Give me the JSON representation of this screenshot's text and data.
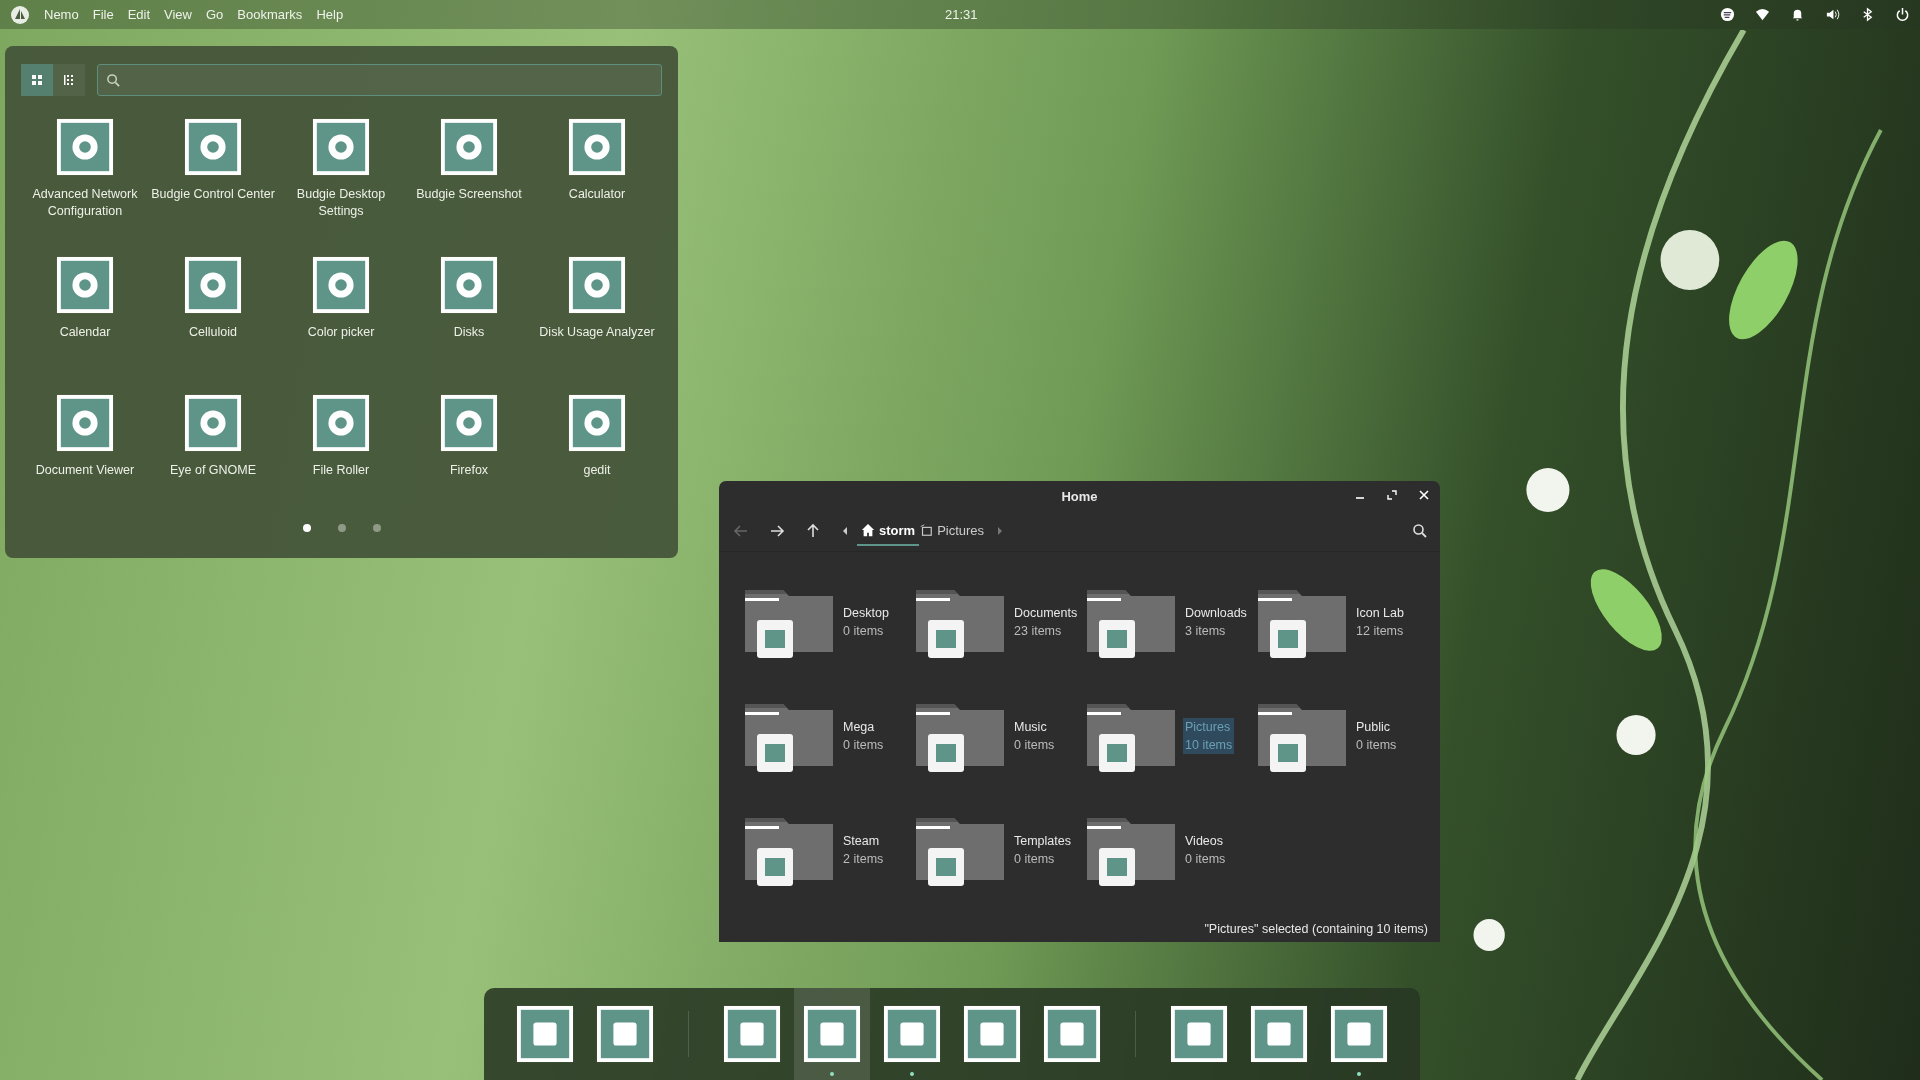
{
  "top_bar": {
    "menu": [
      "Nemo",
      "File",
      "Edit",
      "View",
      "Go",
      "Bookmarks",
      "Help"
    ],
    "clock": "21:31"
  },
  "app_launcher": {
    "view_modes": [
      {
        "kind": "grid",
        "selected": true
      },
      {
        "kind": "list",
        "selected": false
      }
    ],
    "apps": [
      "Advanced Network Configuration",
      "Budgie Control Center",
      "Budgie Desktop Settings",
      "Budgie Screenshot",
      "Calculator",
      "Calendar",
      "Celluloid",
      "Color picker",
      "Disks",
      "Disk Usage Analyzer",
      "Document Viewer",
      "Eye of GNOME",
      "File Roller",
      "Firefox",
      "gedit"
    ],
    "pages": [
      {
        "selected": true
      },
      {
        "selected": false
      },
      {
        "selected": false
      }
    ]
  },
  "file_manager": {
    "window": {
      "title": "Home"
    },
    "path": [
      {
        "kind": "home",
        "label": "storm",
        "selected": true
      },
      {
        "kind": "folder",
        "label": "Pictures",
        "selected": false
      }
    ],
    "folders": [
      {
        "name": "Desktop",
        "count": "0 items",
        "selected": false
      },
      {
        "name": "Documents",
        "count": "23 items",
        "selected": false
      },
      {
        "name": "Downloads",
        "count": "3 items",
        "selected": false
      },
      {
        "name": "Icon Lab",
        "count": "12 items",
        "selected": false
      },
      {
        "name": "Mega",
        "count": "0 items",
        "selected": false
      },
      {
        "name": "Music",
        "count": "0 items",
        "selected": false
      },
      {
        "name": "Pictures",
        "count": "10 items",
        "selected": true
      },
      {
        "name": "Public",
        "count": "0 items",
        "selected": false
      },
      {
        "name": "Steam",
        "count": "2 items",
        "selected": false
      },
      {
        "name": "Templates",
        "count": "0 items",
        "selected": false
      },
      {
        "name": "Videos",
        "count": "0 items",
        "selected": false
      }
    ],
    "status_bar": "\"Pictures\" selected (containing 10 items)"
  },
  "dock": {
    "groups": [
      [
        {
          "running": false,
          "active": false
        },
        {
          "running": false,
          "active": false
        }
      ],
      [
        {
          "running": false,
          "active": false
        },
        {
          "running": true,
          "active": true
        },
        {
          "running": true,
          "active": false
        },
        {
          "running": false,
          "active": false
        },
        {
          "running": false,
          "active": false
        }
      ],
      [
        {
          "running": false,
          "active": false
        },
        {
          "running": false,
          "active": false
        },
        {
          "running": true,
          "active": false
        }
      ]
    ]
  }
}
